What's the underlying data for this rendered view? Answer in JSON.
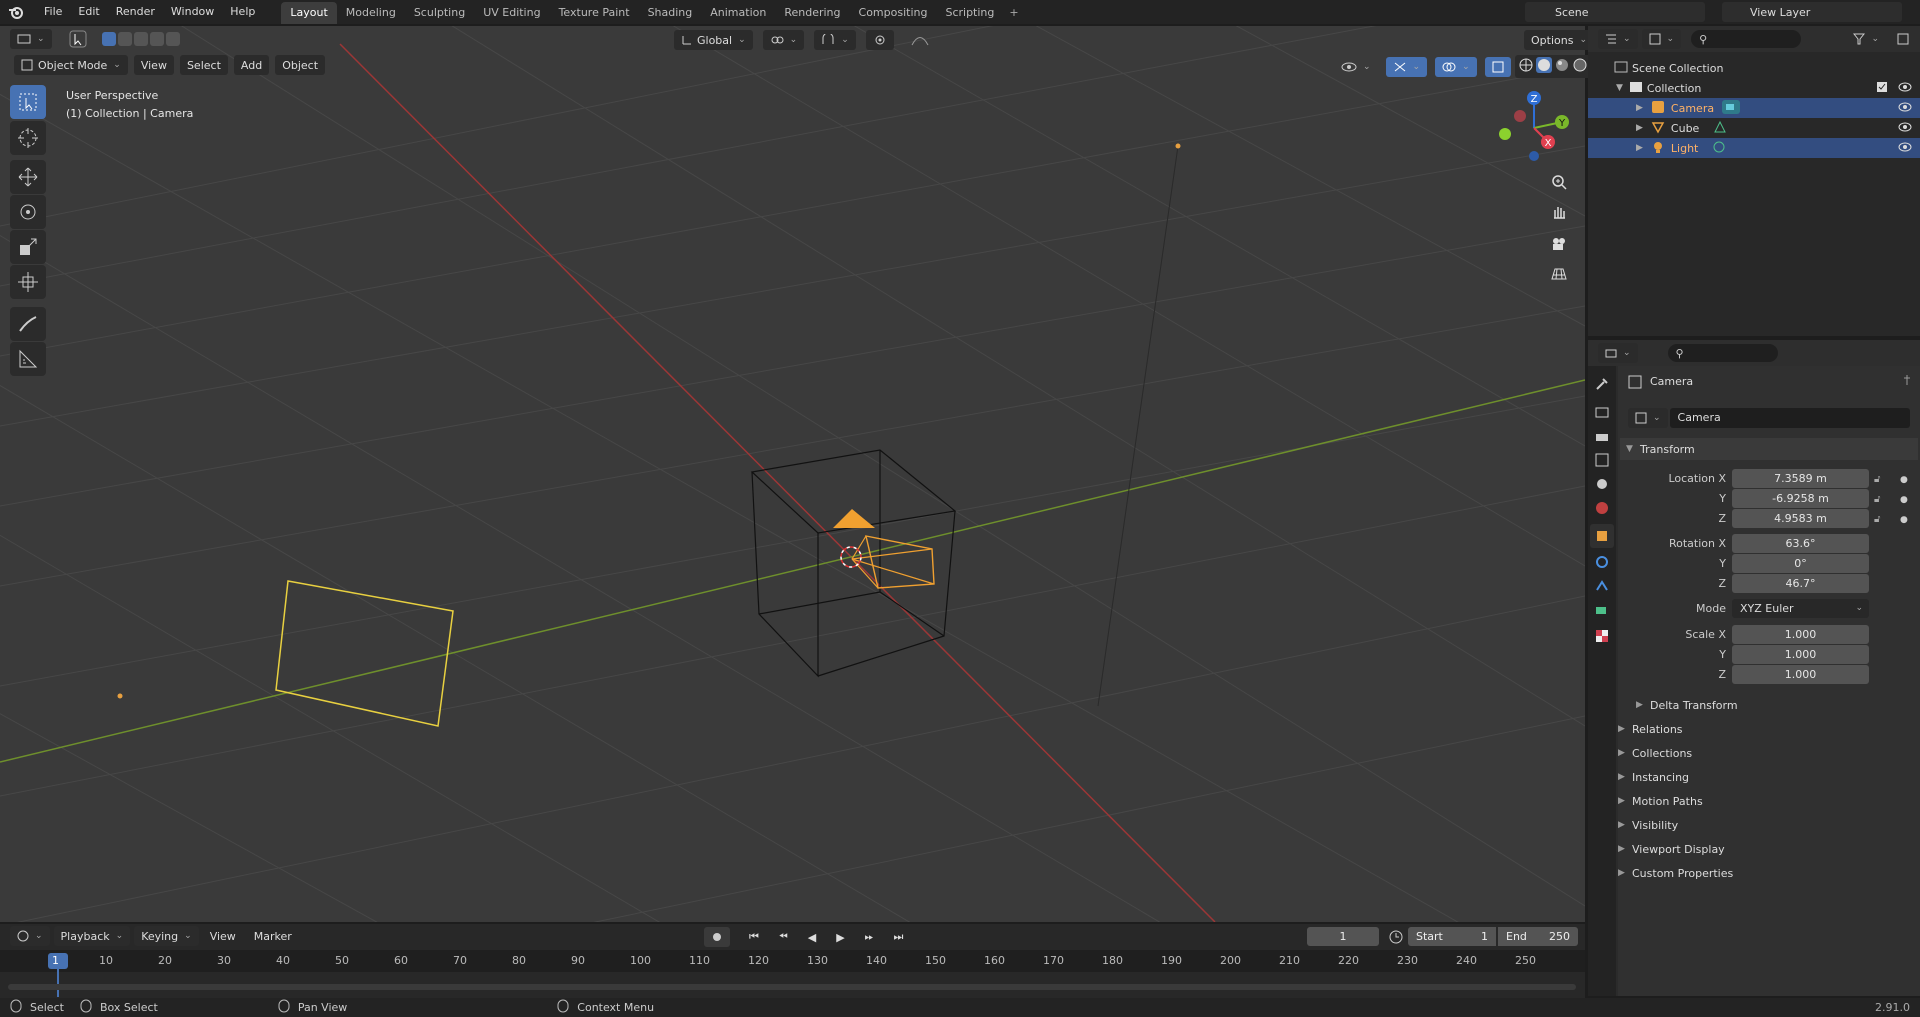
{
  "menubar": {
    "items": [
      "File",
      "Edit",
      "Render",
      "Window",
      "Help"
    ],
    "tabs": [
      "Layout",
      "Modeling",
      "Sculpting",
      "UV Editing",
      "Texture Paint",
      "Shading",
      "Animation",
      "Rendering",
      "Compositing",
      "Scripting"
    ],
    "active_tab": "Layout",
    "scene": "Scene",
    "view_layer": "View Layer"
  },
  "viewport_header": {
    "mode": "Object Mode",
    "menus": [
      "View",
      "Select",
      "Add",
      "Object"
    ],
    "orientation": "Global",
    "options": "Options"
  },
  "viewport": {
    "perspective_label": "User Perspective",
    "collection_label": "(1) Collection | Camera",
    "gizmo_axes": [
      "X",
      "Y",
      "Z"
    ]
  },
  "outliner": {
    "root": "Scene Collection",
    "collection": "Collection",
    "items": [
      {
        "name": "Camera",
        "selected": true,
        "color": "#e8a060"
      },
      {
        "name": "Cube",
        "selected": false,
        "color": "#dddddd"
      },
      {
        "name": "Light",
        "selected": true,
        "color": "#e8a060"
      }
    ]
  },
  "properties": {
    "object_name": "Camera",
    "data_name": "Camera",
    "transform_title": "Transform",
    "location": {
      "label": "Location X",
      "x": "7.3589 m",
      "y": "-6.9258 m",
      "z": "4.9583 m"
    },
    "rotation": {
      "label": "Rotation X",
      "x": "63.6°",
      "y": "0°",
      "z": "46.7°"
    },
    "mode_label": "Mode",
    "mode_value": "XYZ Euler",
    "scale": {
      "label": "Scale X",
      "x": "1.000",
      "y": "1.000",
      "z": "1.000"
    },
    "axis_y": "Y",
    "axis_z": "Z",
    "delta": "Delta Transform",
    "panels": [
      "Relations",
      "Collections",
      "Instancing",
      "Motion Paths",
      "Visibility",
      "Viewport Display",
      "Custom Properties"
    ]
  },
  "timeline": {
    "menus": [
      "Playback",
      "Keying",
      "View",
      "Marker"
    ],
    "current_frame": "1",
    "start_label": "Start",
    "start": "1",
    "end_label": "End",
    "end": "250",
    "ticks": [
      "1",
      "10",
      "20",
      "30",
      "40",
      "50",
      "60",
      "70",
      "80",
      "90",
      "100",
      "110",
      "120",
      "130",
      "140",
      "150",
      "160",
      "170",
      "180",
      "190",
      "200",
      "210",
      "220",
      "230",
      "240",
      "250"
    ]
  },
  "statusbar": {
    "select": "Select",
    "box_select": "Box Select",
    "pan_view": "Pan View",
    "context_menu": "Context Menu",
    "version": "2.91.0"
  }
}
